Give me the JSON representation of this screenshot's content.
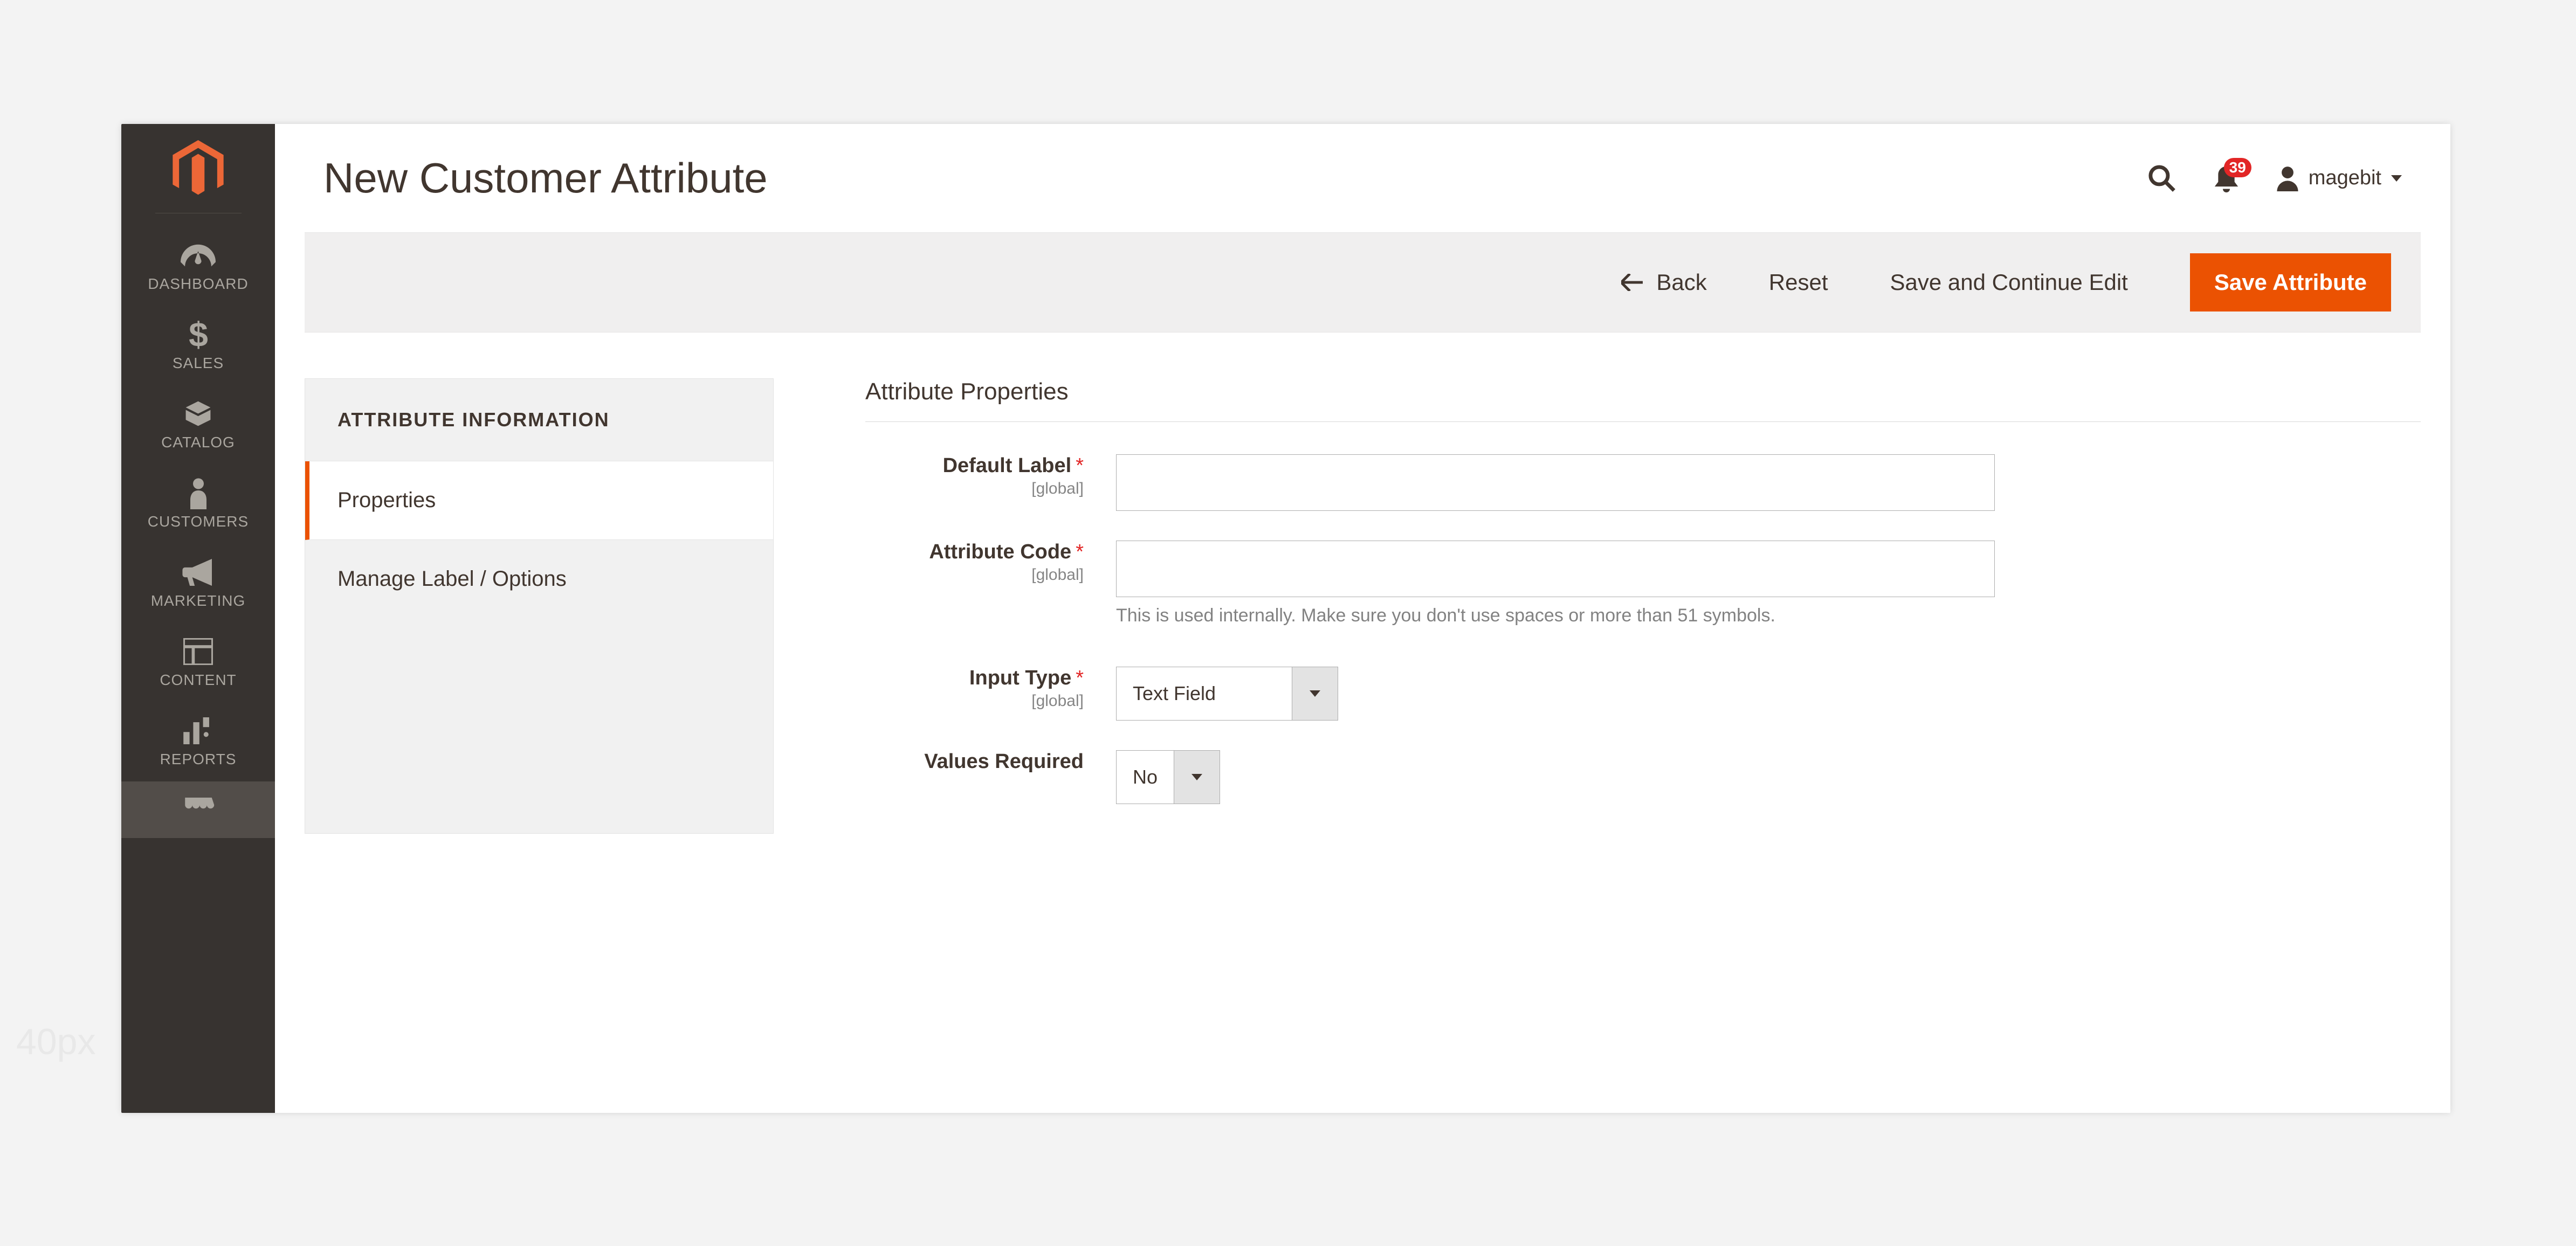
{
  "page": {
    "title": "New Customer Attribute"
  },
  "header": {
    "notification_count": "39",
    "user_name": "magebit"
  },
  "toolbar": {
    "back": "Back",
    "reset": "Reset",
    "save_continue": "Save and Continue Edit",
    "save": "Save Attribute"
  },
  "sidebar_nav": {
    "dashboard": "DASHBOARD",
    "sales": "SALES",
    "catalog": "CATALOG",
    "customers": "CUSTOMERS",
    "marketing": "MARKETING",
    "content": "CONTENT",
    "reports": "REPORTS"
  },
  "side_tabs": {
    "title": "ATTRIBUTE INFORMATION",
    "properties": "Properties",
    "manage": "Manage Label / Options"
  },
  "form": {
    "section_title": "Attribute Properties",
    "scope_global": "[global]",
    "default_label": {
      "label": "Default Label",
      "value": ""
    },
    "attribute_code": {
      "label": "Attribute Code",
      "value": "",
      "hint": "This is used internally. Make sure you don't use spaces or more than 51 symbols."
    },
    "input_type": {
      "label": "Input Type",
      "value": "Text Field"
    },
    "values_required": {
      "label": "Values Required",
      "value": "No"
    }
  },
  "watermark": "40px"
}
